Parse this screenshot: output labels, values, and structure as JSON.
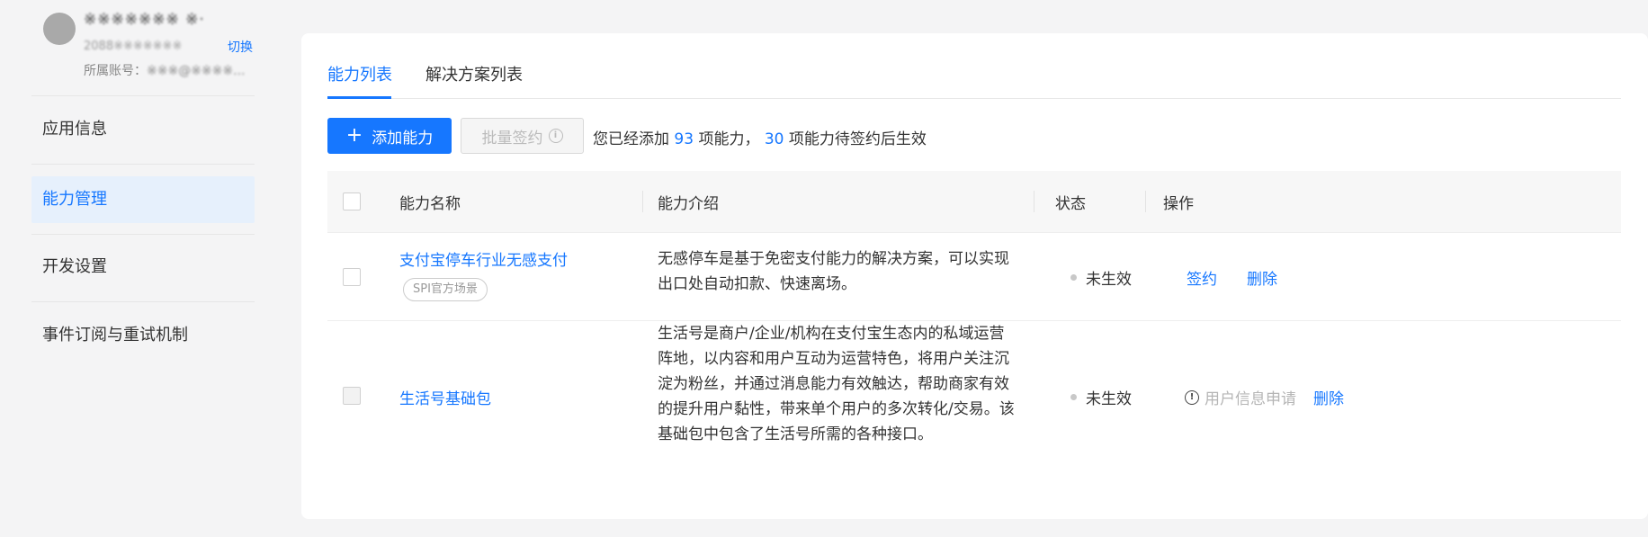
{
  "account": {
    "name": "※※※※※※※ ※·",
    "id": "2088※※※※※※※",
    "switch_label": "切换",
    "belong_label": "所属账号：",
    "belong_value": "※※※@※※※※..."
  },
  "sidebar": {
    "items": [
      {
        "label": "应用信息"
      },
      {
        "label": "能力管理"
      },
      {
        "label": "开发设置"
      },
      {
        "label": "事件订阅与重试机制"
      }
    ]
  },
  "tabs": [
    {
      "label": "能力列表"
    },
    {
      "label": "解决方案列表"
    }
  ],
  "toolbar": {
    "add_label": "添加能力",
    "batch_label": "批量签约",
    "summary_prefix": "您已经添加",
    "added_count": "93",
    "summary_mid": "项能力，",
    "pending_count": "30",
    "summary_suffix": "项能力待签约后生效"
  },
  "table": {
    "headers": {
      "name": "能力名称",
      "intro": "能力介绍",
      "status": "状态",
      "ops": "操作"
    },
    "rows": [
      {
        "name": "支付宝停车行业无感支付",
        "tag": "SPI官方场景",
        "desc": "无感停车是基于免密支付能力的解决方案，可以实现出口处自动扣款、快速离场。",
        "status": "未生效",
        "action1": "签约",
        "action2": "删除"
      },
      {
        "name": "生活号基础包",
        "desc": "生活号是商户/企业/机构在支付宝生态内的私域运营阵地，以内容和用户互动为运营特色，将用户关注沉淀为粉丝，并通过消息能力有效触达，帮助商家有效的提升用户黏性，带来单个用户的多次转化/交易。该基础包中包含了生活号所需的各种接口。",
        "status": "未生效",
        "action1": "用户信息申请",
        "action2": "删除"
      }
    ]
  },
  "colors": {
    "accent": "#1677ff",
    "active_nav_bg": "#e6f0fc"
  }
}
